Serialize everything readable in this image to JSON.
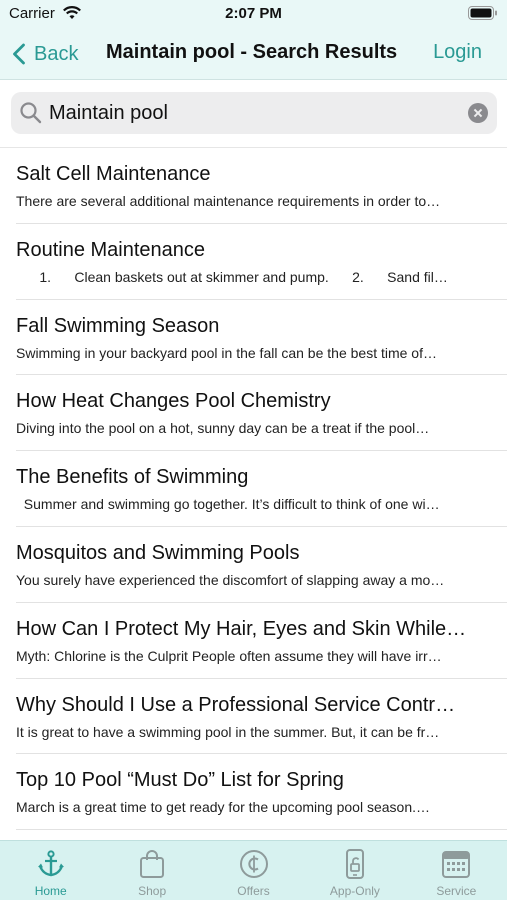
{
  "status_bar": {
    "carrier": "Carrier",
    "time": "2:07 PM"
  },
  "nav": {
    "back_label": "Back",
    "title": "Maintain pool - Search Results",
    "login_label": "Login"
  },
  "search": {
    "value": "Maintain pool"
  },
  "results": [
    {
      "title": "Salt Cell Maintenance",
      "snippet": "There are several additional maintenance requirements in order to…"
    },
    {
      "title": "Routine Maintenance",
      "snippet": "      1.      Clean baskets out at skimmer and pump.      2.      Sand fil…"
    },
    {
      "title": "Fall Swimming Season",
      "snippet": " Swimming in your backyard pool in the fall can be the best time of…"
    },
    {
      "title": "How Heat Changes Pool Chemistry",
      "snippet": " Diving into the pool on a hot, sunny day can be a treat if the pool…"
    },
    {
      "title": "The Benefits of Swimming",
      "snippet": "  Summer and swimming go together. It’s difficult to think of one wi…"
    },
    {
      "title": "Mosquitos and Swimming Pools",
      "snippet": " You surely have experienced the discomfort of slapping away a mo…"
    },
    {
      "title": "How Can I Protect My Hair, Eyes and Skin While…",
      "snippet": " Myth: Chlorine is the Culprit People often assume they will have irr…"
    },
    {
      "title": "Why Should I Use a Professional Service Contr…",
      "snippet": " It is great to have a swimming pool in the summer.  But, it can be fr…"
    },
    {
      "title": "Top 10 Pool “Must Do” List for Spring",
      "snippet": " March is a great time to get ready for the upcoming pool season.…"
    }
  ],
  "tabs": [
    {
      "label": "Home",
      "icon": "anchor-icon",
      "active": true
    },
    {
      "label": "Shop",
      "icon": "shopping-bag-icon",
      "active": false
    },
    {
      "label": "Offers",
      "icon": "cent-coin-icon",
      "active": false
    },
    {
      "label": "App-Only",
      "icon": "phone-unlock-icon",
      "active": false
    },
    {
      "label": "Service",
      "icon": "calendar-icon",
      "active": false
    }
  ],
  "colors": {
    "accent": "#2a9a94",
    "bar_background": "#e9f8f7",
    "tab_bar_background": "#d7f2f0",
    "inactive": "#8e9b9b"
  }
}
